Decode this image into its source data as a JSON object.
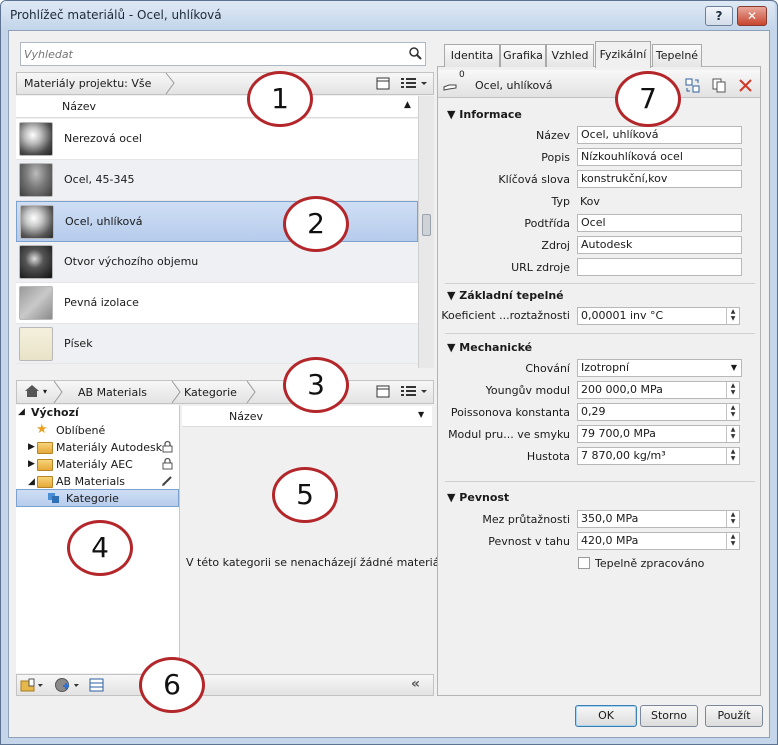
{
  "window": {
    "title": "Prohlížeč materiálů - Ocel, uhlíková",
    "help_label": "?",
    "minimize_label": "—",
    "close_label": "✕"
  },
  "search": {
    "placeholder": "Vyhledat"
  },
  "project_bar": {
    "label": "Materiály projektu: Vše"
  },
  "list": {
    "header": "Název",
    "items": [
      {
        "label": "Nerezová ocel"
      },
      {
        "label": "Ocel, 45-345"
      },
      {
        "label": "Ocel, uhlíková"
      },
      {
        "label": "Otvor výchozího objemu"
      },
      {
        "label": "Pevná izolace"
      },
      {
        "label": "Písek"
      }
    ]
  },
  "library_bar": {
    "crumb1": "AB Materials",
    "crumb2": "Kategorie"
  },
  "tree": {
    "root": "Výchozí",
    "favorites": "Oblíbené",
    "items": [
      "Materiály Autodesk",
      "Materiály AEC",
      "AB Materials"
    ],
    "child": "Kategorie"
  },
  "library_list": {
    "header": "Název",
    "empty": "V této kategorii se nenacházejí žádné materiály."
  },
  "tabs": [
    "Identita",
    "Grafika",
    "Vzhled",
    "Fyzikální",
    "Tepelné"
  ],
  "asset": {
    "count": "0",
    "name": "Ocel, uhlíková"
  },
  "info": {
    "title": "Informace",
    "fields": [
      {
        "label": "Název",
        "value": "Ocel, uhlíková"
      },
      {
        "label": "Popis",
        "value": "Nízkouhlíková ocel"
      },
      {
        "label": "Klíčová slova",
        "value": "konstrukční,kov"
      },
      {
        "label": "Typ",
        "value": "Kov"
      },
      {
        "label": "Podtřída",
        "value": "Ocel"
      },
      {
        "label": "Zdroj",
        "value": "Autodesk"
      },
      {
        "label": "URL zdroje",
        "value": ""
      }
    ]
  },
  "thermal": {
    "title": "Základní tepelné",
    "label": "Koeficient ...roztažnosti",
    "value": "0,00001 inv °C"
  },
  "mechanical": {
    "title": "Mechanické",
    "behavior_label": "Chování",
    "behavior_value": "Izotropní",
    "fields": [
      {
        "label": "Youngův modul",
        "value": "200 000,0 MPa"
      },
      {
        "label": "Poissonova konstanta",
        "value": "0,29"
      },
      {
        "label": "Modul pru... ve smyku",
        "value": "79 700,0 MPa"
      },
      {
        "label": "Hustota",
        "value": "7 870,00 kg/m³"
      }
    ]
  },
  "strength": {
    "title": "Pevnost",
    "fields": [
      {
        "label": "Mez průtažnosti",
        "value": "350,0 MPa"
      },
      {
        "label": "Pevnost v tahu",
        "value": "420,0 MPa"
      }
    ],
    "checkbox": "Tepelně zpracováno"
  },
  "buttons": {
    "ok": "OK",
    "cancel": "Storno",
    "apply": "Použít"
  },
  "callouts": [
    "1",
    "2",
    "3",
    "4",
    "5",
    "6",
    "7"
  ]
}
